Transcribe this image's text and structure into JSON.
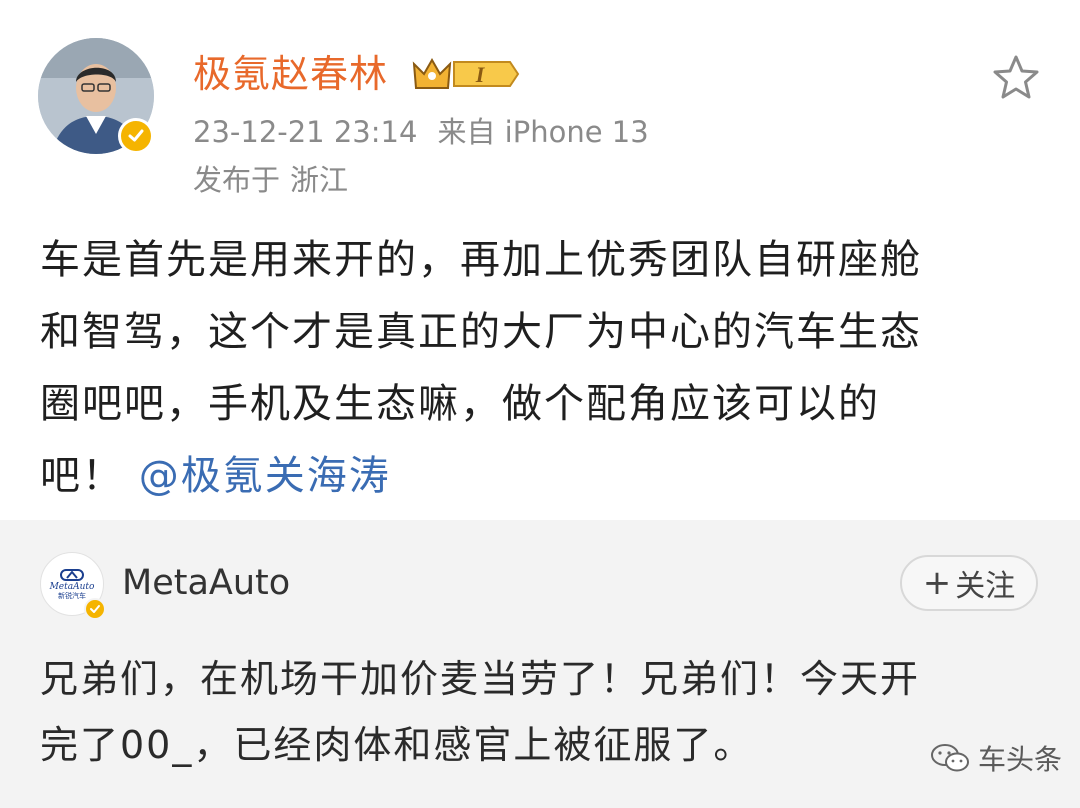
{
  "post": {
    "username": "极氪赵春林",
    "vip_level": "I",
    "date": "23-12-21 23:14",
    "source": "来自 iPhone 13",
    "location_prefix": "发布于",
    "location": "浙江",
    "content_lines": [
      "车是首先是用来开的，再加上优秀团队自研座舱",
      "和智驾，这个才是真正的大厂为中心的汽车生态",
      "圈吧吧，手机及生态嘛，做个配角应该可以的"
    ],
    "content_last_prefix": "吧！",
    "mention": "@极氪关海涛"
  },
  "quoted": {
    "avatar_brand": "MetaAuto",
    "avatar_brand_cn": "新锐汽车",
    "name": "MetaAuto",
    "follow_label": "关注",
    "follow_plus": "+",
    "content_lines": [
      "兄弟们，在机场干加价麦当劳了！兄弟们！今天开",
      "完了00_，已经肉体和感官上被征服了。"
    ]
  },
  "watermark": {
    "text": "车头条"
  },
  "colors": {
    "username": "#e8692b",
    "mention": "#3a6cb3",
    "verified": "#f5b400",
    "quote_bg": "#f3f3f3"
  }
}
